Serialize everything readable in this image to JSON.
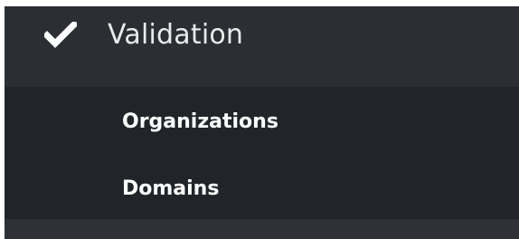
{
  "menu": {
    "header": {
      "icon": "checkmark-icon",
      "label": "Validation"
    },
    "items": [
      {
        "label": "Organizations"
      },
      {
        "label": "Domains"
      }
    ]
  },
  "colors": {
    "header_bg": "#2b2f34",
    "submenu_bg": "#212529",
    "text": "#ffffff"
  }
}
